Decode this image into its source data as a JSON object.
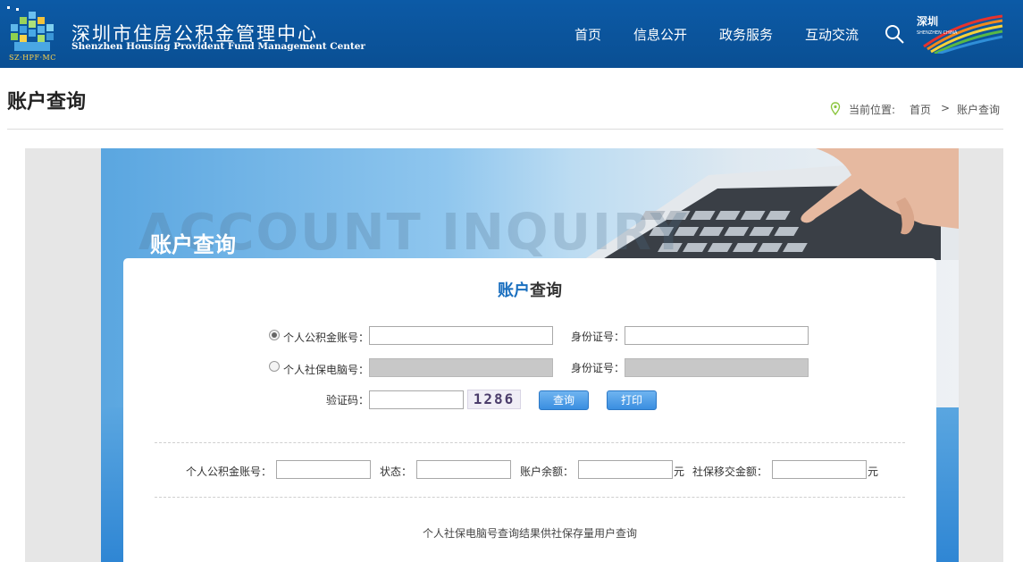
{
  "header": {
    "logo_text": "SZ·HPF·MC",
    "org_name_cn": "深圳市住房公积金管理中心",
    "org_name_en": "Shenzhen Housing Provident Fund Management Center",
    "nav": [
      "首页",
      "信息公开",
      "政务服务",
      "互动交流"
    ],
    "city_logo_cn": "深圳",
    "city_logo_en": "SHENZHEN CHINA"
  },
  "title_bar": {
    "title": "账户查询",
    "location_label": "当前位置:",
    "breadcrumb": [
      "首页",
      ">",
      "账户查询"
    ]
  },
  "banner": {
    "en_text": "ACCOUNT INQUIRY",
    "cn_text": "账户查询"
  },
  "form": {
    "title_highlight": "账户",
    "title_rest": "查询",
    "row1": {
      "label": "个人公积金账号：",
      "id_label": "身份证号：",
      "checked": true,
      "value": "",
      "id_value": ""
    },
    "row2": {
      "label": "个人社保电脑号：",
      "id_label": "身份证号：",
      "checked": false
    },
    "captcha_label": "验证码：",
    "captcha_value": "",
    "captcha_code": "1286",
    "query_button": "查询",
    "print_button": "打印"
  },
  "results": {
    "account_label": "个人公积金账号：",
    "status_label": "状态：",
    "balance_label": "账户余额：",
    "unit": "元",
    "transfer_label": "社保移交金额：",
    "unit2": "元"
  },
  "note": "个人社保电脑号查询结果供社保存量用户查询",
  "colors": {
    "header_bg": "#0c5aa6",
    "accent": "#1a6fbf",
    "button": "#3a8ee0"
  }
}
